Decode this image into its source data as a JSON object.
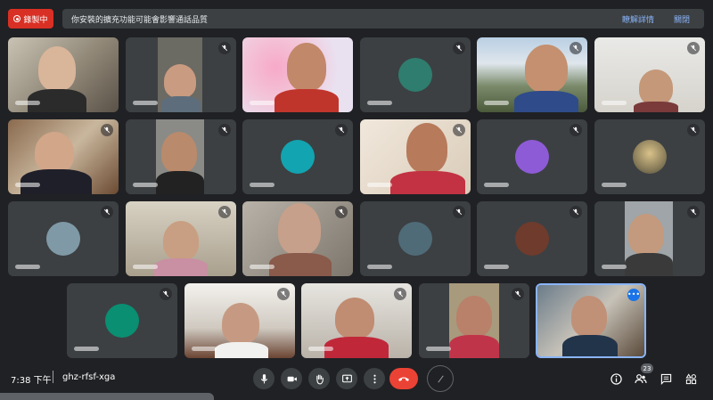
{
  "topbar": {
    "recording_label": "錄製中",
    "notice_text": "你安裝的擴充功能可能會影響通話品質",
    "details_link": "瞭解詳情",
    "close_link": "關閉"
  },
  "meeting": {
    "time": "7:38 下午",
    "separator": "|",
    "code": "ghz-rfsf-xga",
    "participants_count": "23"
  },
  "controls": [
    "microphone-icon",
    "camera-icon",
    "raise-hand-icon",
    "present-icon",
    "more-options-icon",
    "hang-up-icon",
    "companion-icon"
  ],
  "right_controls": [
    "info-icon",
    "people-icon",
    "chat-icon",
    "activities-icon"
  ],
  "tiles": [
    {
      "kind": "video"
    },
    {
      "kind": "video"
    },
    {
      "kind": "video"
    },
    {
      "kind": "avatar",
      "color": "#2e7d6e"
    },
    {
      "kind": "video"
    },
    {
      "kind": "video"
    },
    {
      "kind": "video"
    },
    {
      "kind": "video"
    },
    {
      "kind": "avatar",
      "color": "#12a4b0"
    },
    {
      "kind": "video"
    },
    {
      "kind": "avatar",
      "color": "#8e5bd6"
    },
    {
      "kind": "avatar",
      "color": "#8a7d5a"
    },
    {
      "kind": "avatar",
      "color": "#7f9aa6"
    },
    {
      "kind": "video"
    },
    {
      "kind": "video"
    },
    {
      "kind": "avatar",
      "color": "#4f6b78"
    },
    {
      "kind": "avatar",
      "color": "#6e3b2c"
    },
    {
      "kind": "video"
    },
    {
      "kind": "avatar",
      "color": "#0a8f72"
    },
    {
      "kind": "video"
    },
    {
      "kind": "video"
    },
    {
      "kind": "video"
    },
    {
      "kind": "video",
      "selected": true
    }
  ]
}
